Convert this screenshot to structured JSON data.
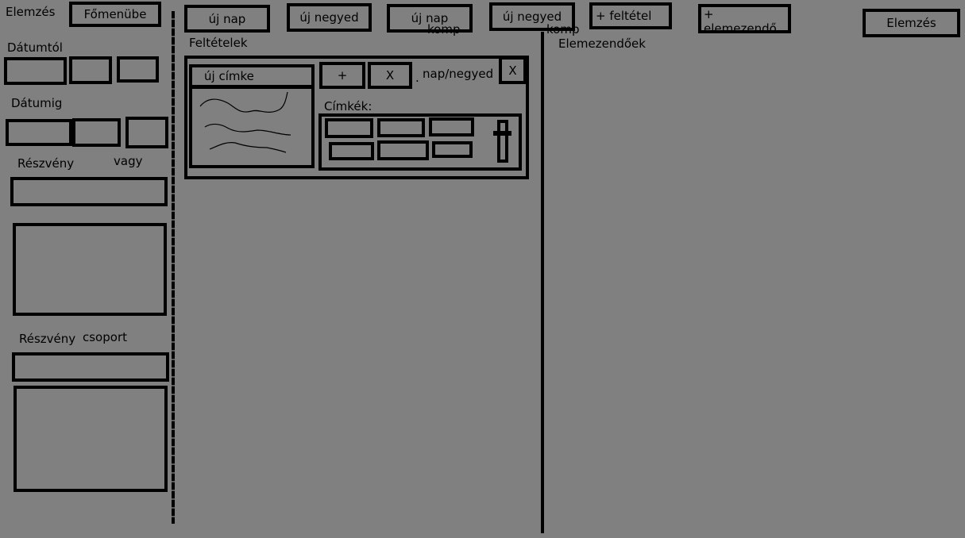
{
  "header": {
    "app_title": "Elemzés",
    "main_menu_button": "Főmenübe"
  },
  "toolbar": {
    "new_day": "új nap",
    "new_quarter": "új negyed",
    "new_day_comp": "új nap",
    "new_day_comp_suffix": "komp",
    "new_quarter_comp": "új negyed",
    "new_quarter_comp_suffix": "komp",
    "add_condition": "+ feltétel",
    "add_to_analyze": "+ elemezendő",
    "analyze": "Elemzés"
  },
  "sidebar": {
    "date_from_label": "Dátumtól",
    "date_to_label": "Dátumig",
    "stock_label": "Részvény",
    "or_label": "vagy",
    "stock_group_label": "Részvény",
    "stock_group_suffix": "csoport"
  },
  "conditions": {
    "heading": "Feltételek",
    "card": {
      "new_label_button": "új címke",
      "plus_button": "+",
      "remove_button": "X",
      "dot": ".",
      "period_label": "nap/negyed",
      "close_button": "X",
      "labels_heading": "Címkék:"
    }
  },
  "analysis": {
    "heading": "Elemezendőek"
  }
}
